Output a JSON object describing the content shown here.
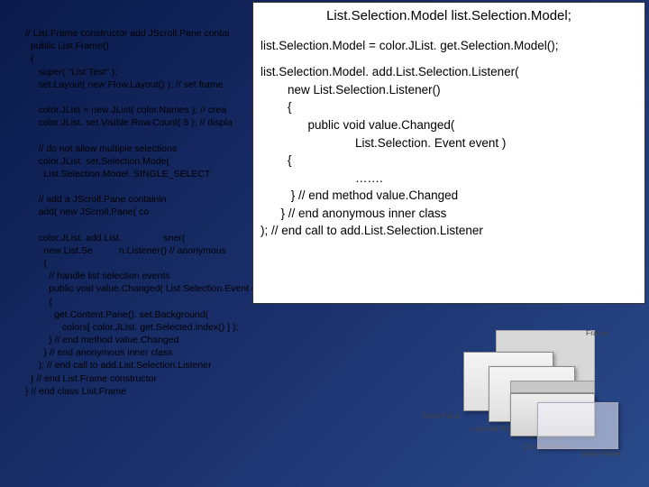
{
  "background_code": "// List.Frame constructor add JScroll.Pane contai\n  public List.Frame()\n  {\n     super( \"List Test\" );\n     set.Layout( new Flow.Layout() ); // set frame \n\n     color.JList = new JList( color.Names ); // crea\n     color.JList. set.Visible.Row.Count( 5 ); // displa\n\n     // do not allow multiple selections\n     color.JList. set.Selection.Mode(\n       List.Selection.Model. SINGLE_SELECT\n\n     // add a JScroll.Pane containin\n     add( new JScroll.Pane( co\n\n     color.JList. add.List.                sner(\n       new List.Se          n.Listener() // anonymous       \n       {\n         // handle list selection events\n         public void value.Changed( List.Selection.Event event )\n         {\n           get.Content.Pane(). set.Background(\n              colors[ color.JList. get.Selected.Index() ] );\n         } // end method value.Changed\n       } // end anonymous inner class\n     ); // end call to add.List.Selection.Listener\n  } // end List.Frame constructor\n} // end class List.Frame",
  "overlay": {
    "title": "List.Selection.Model list.Selection.Model;",
    "l1": "list.Selection.Model = color.JList. get.Selection.Model();",
    "l2": "list.Selection.Model. add.List.Selection.Listener(",
    "l3": "        new List.Selection.Listener()",
    "l4": "        {",
    "l5": "              public void value.Changed(",
    "l6": "                            List.Selection. Event event )",
    "l7": "        {",
    "l8": "                            …….",
    "l9": "         } // end method value.Changed",
    "l10": "      } // end anonymous inner class",
    "l11": "); // end call to add.List.Selection.Listener"
  },
  "diagram": {
    "frame": "Frame",
    "root": "Root Pane",
    "layered": "Layered Pane",
    "menubar": "Menu Bar",
    "content": "Content Pane",
    "glass": "Glass Pane"
  }
}
